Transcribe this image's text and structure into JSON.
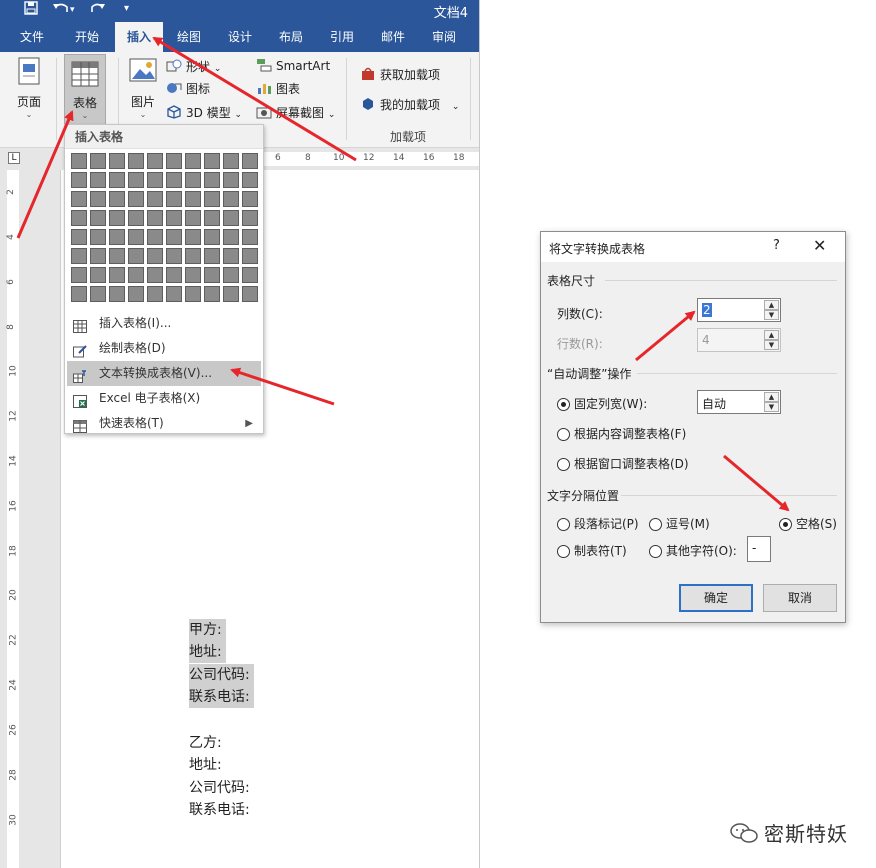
{
  "window": {
    "title": "文档4"
  },
  "quick_access": {
    "save_icon": "save-icon",
    "undo_icon": "undo-icon",
    "redo_icon": "redo-icon",
    "customize_icon": "customize-icon"
  },
  "tabs": [
    {
      "label": "文件"
    },
    {
      "label": "开始"
    },
    {
      "label": "插入",
      "active": true
    },
    {
      "label": "绘图"
    },
    {
      "label": "设计"
    },
    {
      "label": "布局"
    },
    {
      "label": "引用"
    },
    {
      "label": "邮件"
    },
    {
      "label": "审阅"
    }
  ],
  "ribbon": {
    "page_label": "页面",
    "table_label": "表格",
    "picture_label": "图片",
    "shapes_label": "形状",
    "icons_label": "图标",
    "model3d_label": "3D 模型",
    "smartart_label": "SmartArt",
    "chart_label": "图表",
    "screenshot_label": "屏幕截图",
    "get_addins_label": "获取加载项",
    "my_addins_label": "我的加载项",
    "addins_group_label": "加载项"
  },
  "ruler": {
    "h_ticks": [
      "6",
      "8",
      "10",
      "12",
      "14",
      "16",
      "18"
    ],
    "v_ticks": [
      "2",
      "4",
      "6",
      "8",
      "10",
      "12",
      "14",
      "16",
      "18",
      "20",
      "22",
      "24",
      "26",
      "28",
      "30"
    ],
    "corner": "L"
  },
  "table_menu": {
    "title": "插入表格",
    "items": [
      {
        "label": "插入表格(I)..."
      },
      {
        "label": "绘制表格(D)"
      },
      {
        "label": "文本转换成表格(V)..."
      },
      {
        "label": "Excel 电子表格(X)"
      },
      {
        "label": "快速表格(T)"
      }
    ]
  },
  "document": {
    "lines_a": [
      "甲方:",
      "地址:",
      "公司代码:",
      "联系电话:"
    ],
    "lines_b": [
      "乙方:",
      "地址:",
      "公司代码:",
      "联系电话:"
    ]
  },
  "dialog": {
    "title": "将文字转换成表格",
    "help": "?",
    "close": "✕",
    "size_section": "表格尺寸",
    "columns_label": "列数(C):",
    "columns_value": "2",
    "rows_label": "行数(R):",
    "rows_value": "4",
    "autofit_section": "“自动调整”操作",
    "fixed_width_label": "固定列宽(W):",
    "fixed_width_value": "自动",
    "fit_content_label": "根据内容调整表格(F)",
    "fit_window_label": "根据窗口调整表格(D)",
    "separator_section": "文字分隔位置",
    "paragraph_label": "段落标记(P)",
    "comma_label": "逗号(M)",
    "space_label": "空格(S)",
    "tab_label": "制表符(T)",
    "other_label": "其他字符(O):",
    "other_value": "-",
    "ok_label": "确定",
    "cancel_label": "取消"
  },
  "watermark": {
    "text": "密斯特妖"
  },
  "colors": {
    "accent": "#2b579a",
    "arrow": "#e5262b",
    "highlight": "#d0d0d0"
  }
}
